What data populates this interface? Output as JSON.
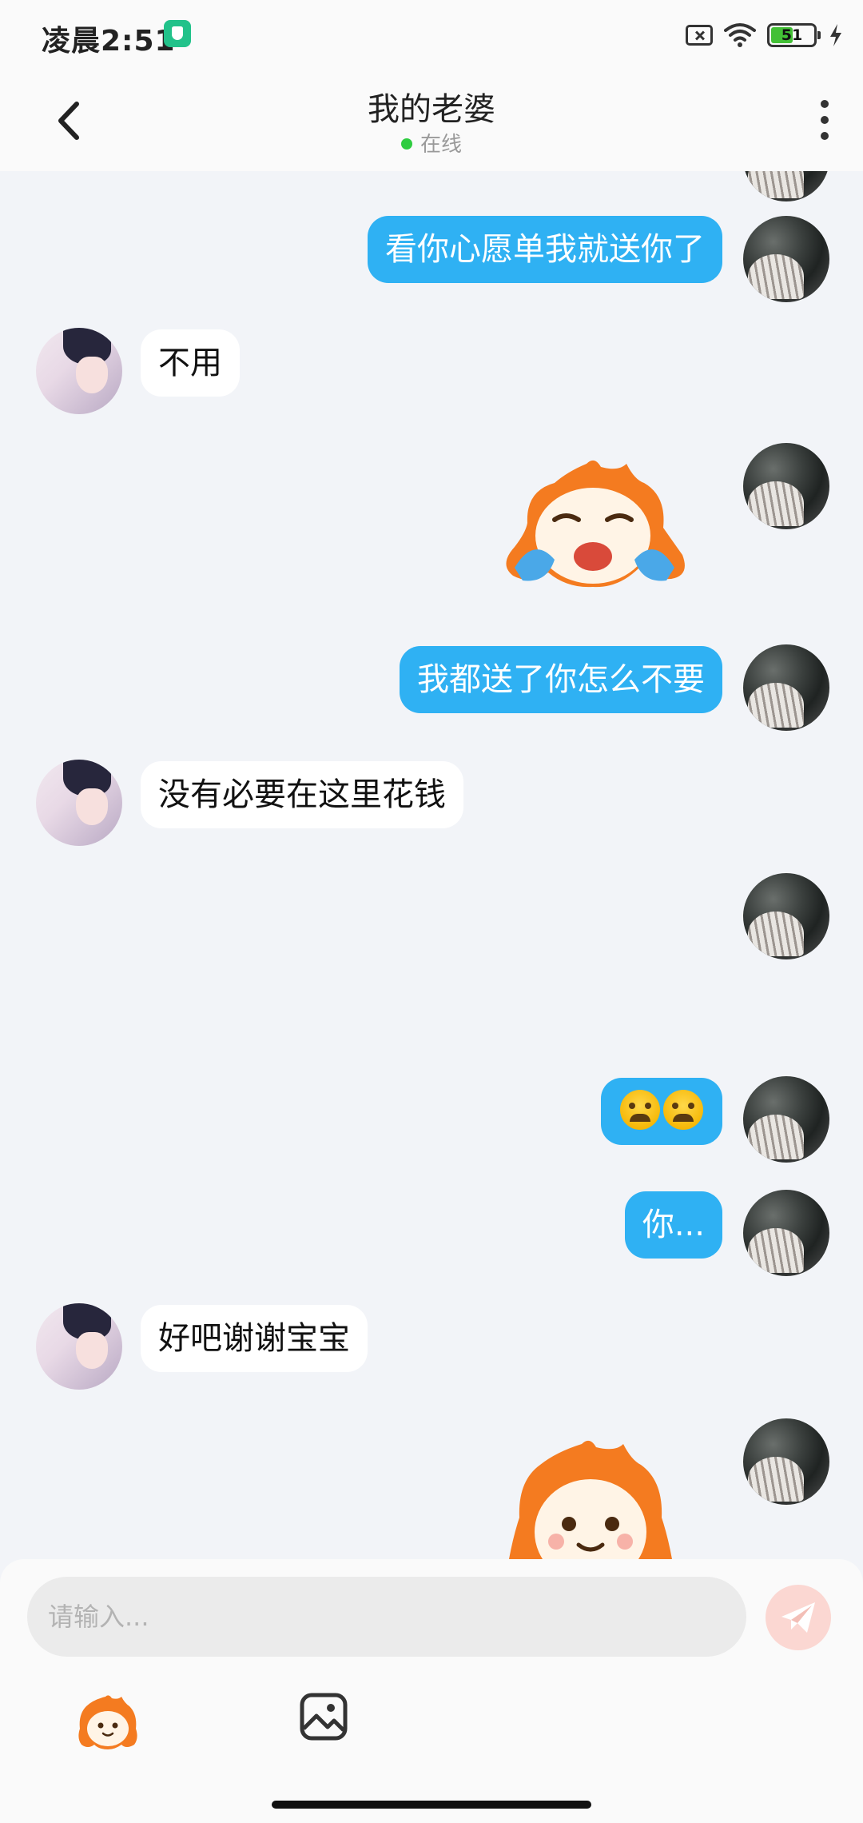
{
  "status_bar": {
    "time": "凌晨2:51",
    "battery": "51"
  },
  "header": {
    "title": "我的老婆",
    "status": "在线"
  },
  "messages": [
    {
      "side": "me",
      "type": "text",
      "text": "看你心愿单我就送你了"
    },
    {
      "side": "her",
      "type": "text",
      "text": "不用"
    },
    {
      "side": "me",
      "type": "sticker",
      "sticker": "crying-mascot-sticker"
    },
    {
      "side": "me",
      "type": "text",
      "text": "我都送了你怎么不要"
    },
    {
      "side": "her",
      "type": "text",
      "text": "没有必要在这里花钱"
    },
    {
      "side": "me",
      "type": "empty"
    },
    {
      "side": "me",
      "type": "emoji",
      "emoji": [
        "anxious-face-emoji",
        "anxious-face-emoji"
      ]
    },
    {
      "side": "me",
      "type": "text",
      "text": "你..."
    },
    {
      "side": "her",
      "type": "text",
      "text": "好吧谢谢宝宝"
    },
    {
      "side": "me",
      "type": "sticker",
      "sticker": "smiling-mascot-sticker"
    }
  ],
  "composer": {
    "placeholder": "请输入..."
  },
  "colors": {
    "my_bubble": "#2fb1f3",
    "her_bubble": "#ffffff",
    "chat_background": "#f2f4f8",
    "online_dot": "#2ecc40",
    "send_button": "#fbd7d2"
  }
}
